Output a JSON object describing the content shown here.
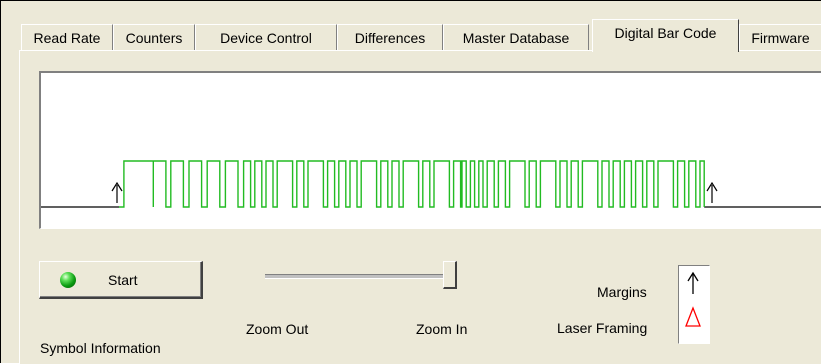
{
  "tabs": [
    {
      "label": "Read Rate",
      "active": false
    },
    {
      "label": "Counters",
      "active": false
    },
    {
      "label": "Device Control",
      "active": false
    },
    {
      "label": "Differences",
      "active": false
    },
    {
      "label": "Master Database",
      "active": false
    },
    {
      "label": "Digital Bar Code",
      "active": true
    },
    {
      "label": "Firmware",
      "active": false
    }
  ],
  "controls": {
    "start_label": "Start",
    "symbol_info_label": "Symbol Information",
    "zoom_out_label": "Zoom Out",
    "zoom_in_label": "Zoom In",
    "zoom_level": 1.0
  },
  "legend": {
    "margins_label": "Margins",
    "laser_framing_label": "Laser Framing",
    "margins_icon": "up-arrow-icon",
    "laser_framing_icon": "triangle-icon"
  },
  "colors": {
    "signal": "#22bb22",
    "baseline": "#000000",
    "led": "#11aa11",
    "laser_framing": "#ff0000"
  },
  "signal": {
    "pulses": [
      [
        0.35,
        2.1
      ],
      [
        2.45,
        0.9
      ],
      [
        3.7,
        0.9
      ],
      [
        5.0,
        0.9
      ],
      [
        6.3,
        0.9
      ],
      [
        7.6,
        0.9
      ],
      [
        8.9,
        0.5
      ],
      [
        9.7,
        0.5
      ],
      [
        10.5,
        0.5
      ],
      [
        11.3,
        1.1
      ],
      [
        12.7,
        0.5
      ],
      [
        13.5,
        1.1
      ],
      [
        14.9,
        0.5
      ],
      [
        15.7,
        0.5
      ],
      [
        16.5,
        0.5
      ],
      [
        17.3,
        1.1
      ],
      [
        18.7,
        0.5
      ],
      [
        19.5,
        0.5
      ],
      [
        20.3,
        1.1
      ],
      [
        21.7,
        0.5
      ],
      [
        22.5,
        1.1
      ],
      [
        23.9,
        0.5
      ],
      [
        24.5,
        0.3
      ],
      [
        25.1,
        0.3
      ],
      [
        25.7,
        0.3
      ],
      [
        26.3,
        0.5
      ],
      [
        27.1,
        0.5
      ],
      [
        27.9,
        1.1
      ],
      [
        29.3,
        0.5
      ],
      [
        30.1,
        1.1
      ],
      [
        31.5,
        0.5
      ],
      [
        32.3,
        0.5
      ],
      [
        33.1,
        1.1
      ],
      [
        34.5,
        0.5
      ],
      [
        35.3,
        0.5
      ],
      [
        36.1,
        0.5
      ],
      [
        36.9,
        0.5
      ],
      [
        37.7,
        0.5
      ],
      [
        38.5,
        1.1
      ],
      [
        39.9,
        0.5
      ],
      [
        40.7,
        0.5
      ],
      [
        41.5,
        0.3
      ]
    ]
  }
}
